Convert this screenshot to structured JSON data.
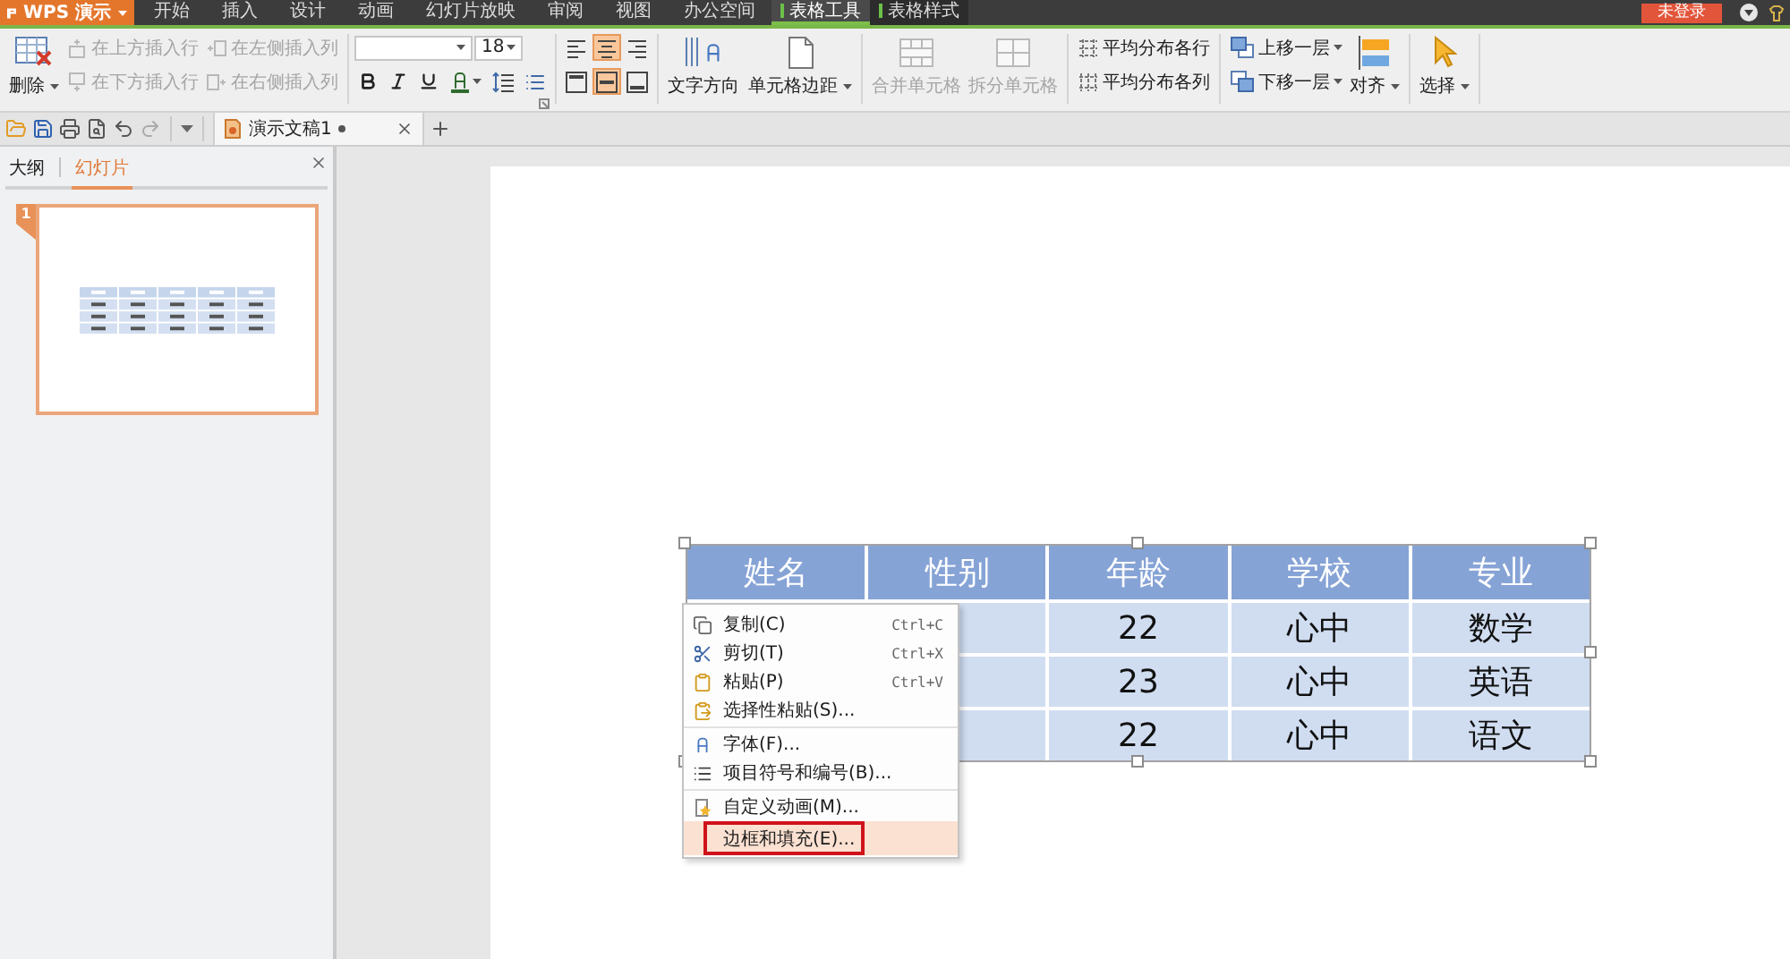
{
  "app_button": {
    "label": "WPS 演示"
  },
  "menu_tabs": [
    {
      "label": "开始",
      "kind": "main",
      "selected": false
    },
    {
      "label": "插入",
      "kind": "main",
      "selected": false
    },
    {
      "label": "设计",
      "kind": "main",
      "selected": false
    },
    {
      "label": "动画",
      "kind": "main",
      "selected": false
    },
    {
      "label": "幻灯片放映",
      "kind": "main",
      "selected": false
    },
    {
      "label": "审阅",
      "kind": "main",
      "selected": false
    },
    {
      "label": "视图",
      "kind": "main",
      "selected": false
    },
    {
      "label": "办公空间",
      "kind": "main",
      "selected": false
    },
    {
      "label": "表格工具",
      "kind": "context",
      "selected": true
    },
    {
      "label": "表格样式",
      "kind": "context",
      "selected": false
    }
  ],
  "login_button": {
    "label": "未登录"
  },
  "ribbon": {
    "delete_button": {
      "label": "删除"
    },
    "insert_buttons": [
      {
        "label": "在上方插入行",
        "kind": "row-above",
        "disabled": true
      },
      {
        "label": "在左侧插入列",
        "kind": "col-left",
        "disabled": true
      },
      {
        "label": "在下方插入行",
        "kind": "row-below",
        "disabled": true
      },
      {
        "label": "在右侧插入列",
        "kind": "col-right",
        "disabled": true
      }
    ],
    "font_size": {
      "value": "18"
    },
    "align": {
      "horizontal": [
        {
          "kind": "left",
          "selected": false
        },
        {
          "kind": "center",
          "selected": true
        },
        {
          "kind": "right",
          "selected": false
        }
      ],
      "vertical": [
        {
          "kind": "top",
          "selected": false
        },
        {
          "kind": "middle",
          "selected": true
        },
        {
          "kind": "bottom",
          "selected": false
        }
      ]
    },
    "text_direction_button": {
      "label": "文字方向"
    },
    "cell_margin_button": {
      "label": "单元格边距"
    },
    "merge_buttons": [
      {
        "label": "合并单元格",
        "kind": "merge",
        "disabled": true
      },
      {
        "label": "拆分单元格",
        "kind": "split",
        "disabled": true
      }
    ],
    "distribute_buttons": [
      {
        "label": "平均分布各行",
        "kind": "rows"
      },
      {
        "label": "平均分布各列",
        "kind": "columns"
      }
    ],
    "layer_buttons": [
      {
        "label": "上移一层",
        "kind": "up"
      },
      {
        "label": "下移一层",
        "kind": "down"
      }
    ],
    "align_button": {
      "label": "对齐"
    },
    "select_button": {
      "label": "选择"
    }
  },
  "document_tab": {
    "title": "演示文稿1",
    "modified": true
  },
  "panel_tabs": [
    {
      "label": "大纲",
      "selected": false
    },
    {
      "label": "幻灯片",
      "selected": true
    }
  ],
  "slides": [
    {
      "number": "1",
      "selected": true
    }
  ],
  "table": {
    "columns": [
      "姓名",
      "性别",
      "年龄",
      "学校",
      "专业"
    ],
    "rows": [
      {
        "cells": [
          "",
          "",
          "22",
          "心中",
          "数学"
        ]
      },
      {
        "cells": [
          "",
          "",
          "23",
          "心中",
          "英语"
        ]
      },
      {
        "cells": [
          "",
          "",
          "22",
          "心中",
          "语文"
        ]
      }
    ]
  },
  "context_menu": {
    "groups": [
      {
        "items": [
          {
            "kind": "copy",
            "label": "复制(C)",
            "shortcut": "Ctrl+C",
            "selected": false,
            "annotated": false
          },
          {
            "kind": "cut",
            "label": "剪切(T)",
            "shortcut": "Ctrl+X",
            "selected": false,
            "annotated": false
          },
          {
            "kind": "paste",
            "label": "粘贴(P)",
            "shortcut": "Ctrl+V",
            "selected": false,
            "annotated": false
          },
          {
            "kind": "paste-special",
            "label": "选择性粘贴(S)...",
            "selected": false,
            "annotated": false
          }
        ]
      },
      {
        "items": [
          {
            "kind": "font",
            "label": "字体(F)...",
            "selected": false,
            "annotated": false
          },
          {
            "kind": "bullets",
            "label": "项目符号和编号(B)...",
            "selected": false,
            "annotated": false
          }
        ]
      },
      {
        "items": [
          {
            "kind": "animation",
            "label": "自定义动画(M)...",
            "selected": false,
            "annotated": false
          },
          {
            "kind": "border",
            "label": "边框和填充(E)...",
            "selected": true,
            "annotated": true
          }
        ]
      }
    ]
  }
}
